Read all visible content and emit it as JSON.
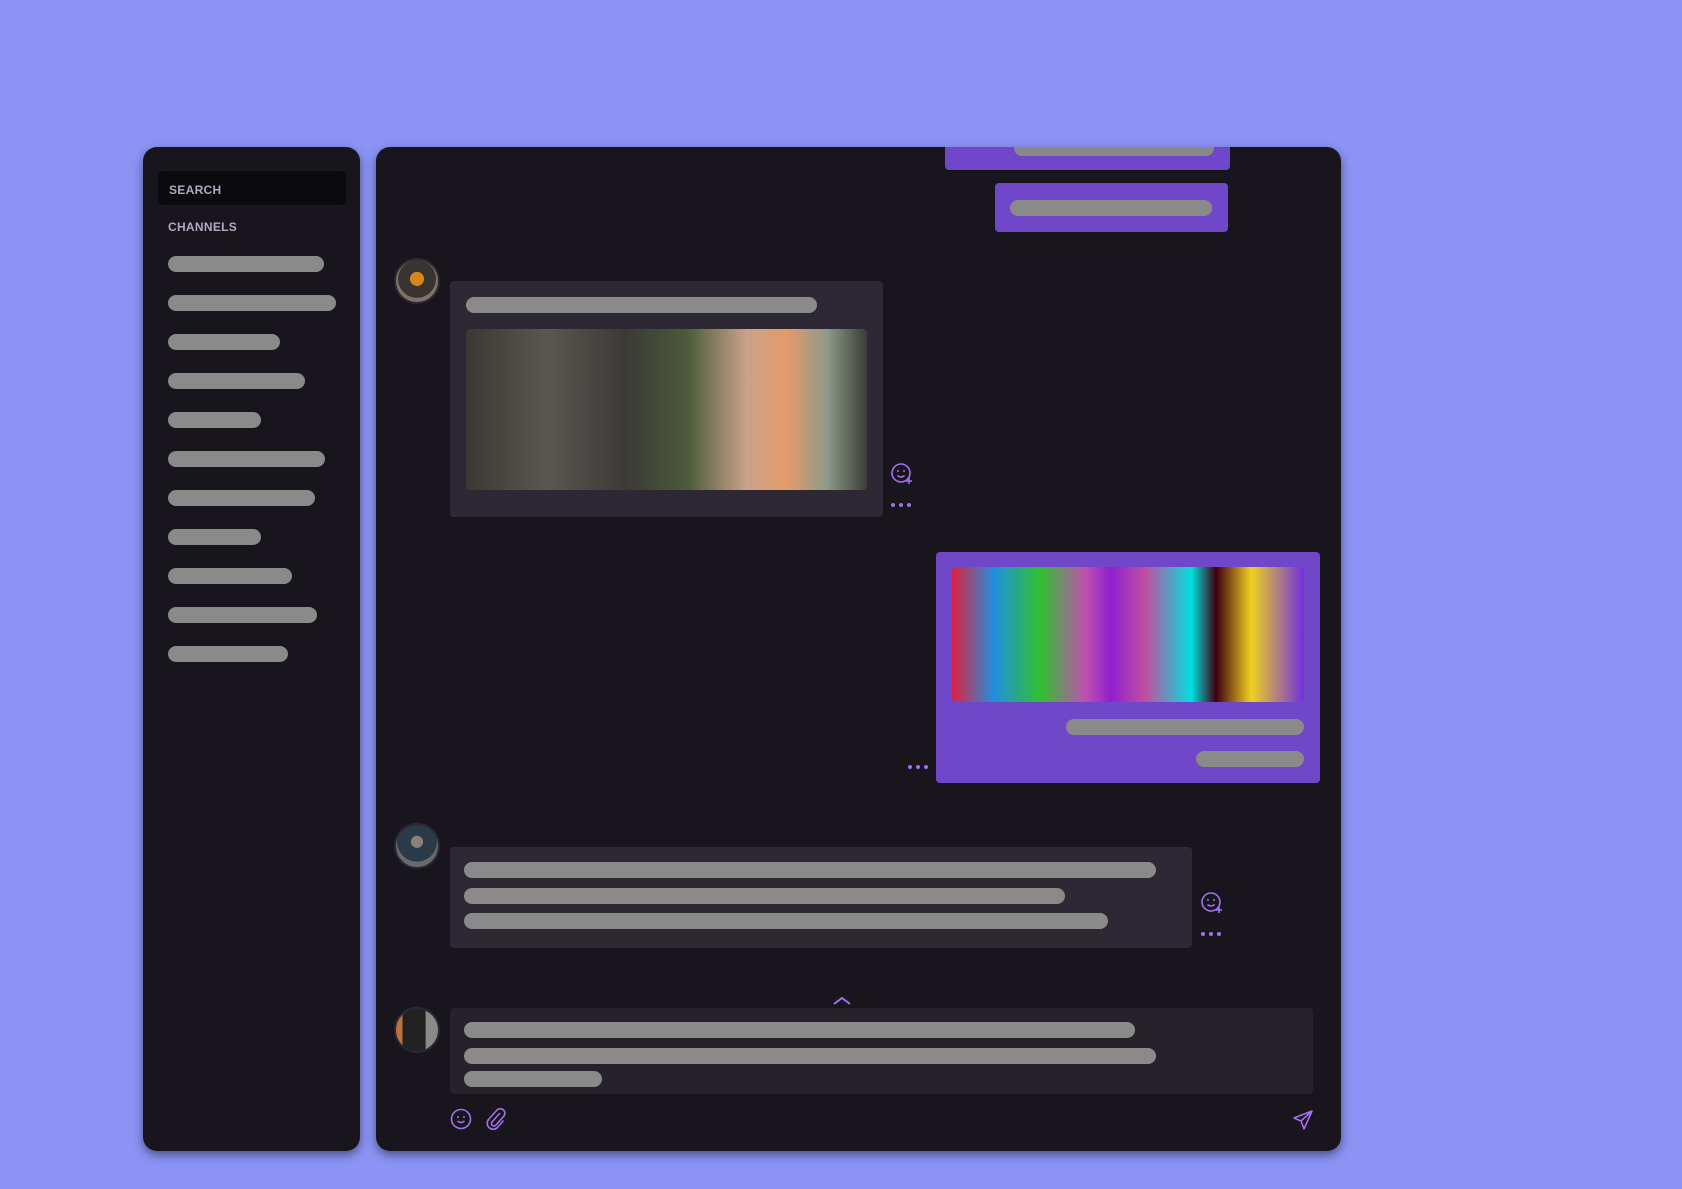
{
  "sidebar": {
    "search_label": "SEARCH",
    "channels_label": "CHANNELS",
    "channel_count": 11
  },
  "colors": {
    "background": "#8b93f5",
    "panel": "#18161c",
    "incoming_bubble": "#2e2834",
    "outgoing_bubble": "#6f47c8",
    "accent": "#a070f0",
    "placeholder": "#8a8a8a"
  },
  "icons": {
    "react": "emoji-add-icon",
    "more": "more-dots-icon",
    "scroll": "chevron-up-icon",
    "emoji": "emoji-icon",
    "attach": "paperclip-icon",
    "send": "send-icon"
  }
}
